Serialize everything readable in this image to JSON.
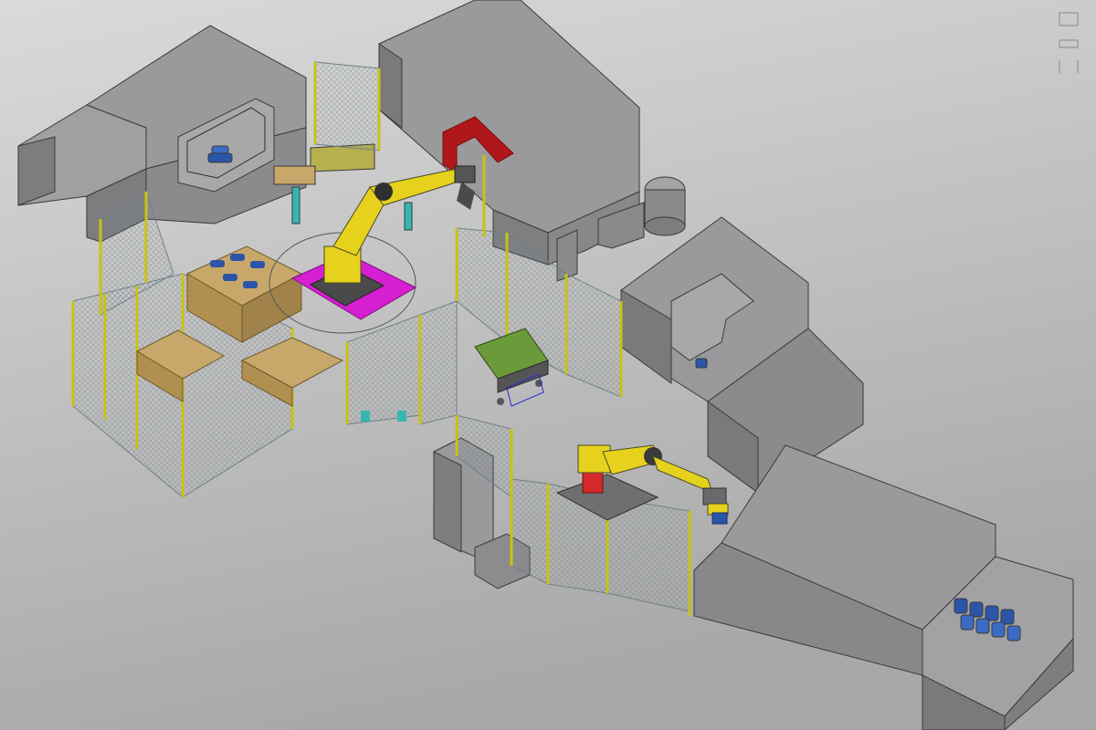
{
  "scene": {
    "kind": "isometric robotic work cell layout",
    "colors": {
      "background_top": "#d9d9d9",
      "background_bottom": "#a9a9a9",
      "machine_top": "#9a9a9c",
      "machine_side_light": "#8c8c8e",
      "machine_side_dark": "#737375",
      "fence_post": "#c9c214",
      "fence_mesh": "#6f8086",
      "robot_yellow": "#e6d21c",
      "robot_dark": "#4a4a2a",
      "base_magenta": "#d61fd0",
      "part_blue": "#2b55a8",
      "wood": "#c8a86a",
      "pedestal_cyan": "#35b7b0",
      "door_red": "#b0171b"
    },
    "objects": {
      "machines": [
        "machine-left",
        "machine-top",
        "machine-right",
        "machine-front-right",
        "machine-lower-left"
      ],
      "robots": [
        "robot-palletizer",
        "robot-loader"
      ],
      "fences": [
        "fence-left",
        "fence-center",
        "fence-lower"
      ],
      "icons": [
        "robot-icon",
        "pallet-icon",
        "fence-icon"
      ]
    }
  }
}
